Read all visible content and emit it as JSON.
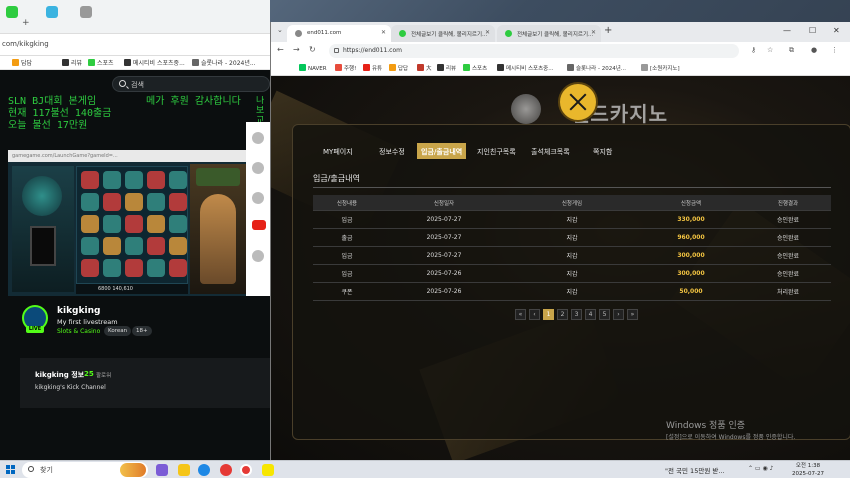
{
  "colors": {
    "kick_green": "#53fc18",
    "overlay_green": "#2ecc40",
    "site_gold": "#c9a54a",
    "amount_yellow": "#f4c542"
  },
  "left_browser": {
    "address": "com/kikgking",
    "bookmarks": [
      "답답",
      "리뷰",
      "스포츠",
      "메시티비 스포츠중...",
      "슬롯나라 - 2024년..."
    ],
    "search_placeholder": "검색",
    "overlay": {
      "line1": "SLN BJ대회 본게임",
      "line1b": "메가 후원 감사합니다",
      "line2": "현재 117불선 140출금",
      "line3": "오늘 불선 17만원",
      "side": "나보교리"
    },
    "stream_url": "gamegame.com/LaunchGame?gameId=...",
    "stream_hud": "6800 140,610",
    "channel": {
      "name": "kikgking",
      "title": "My first livestream",
      "category": "Slots & Casino",
      "tags": [
        "Korean",
        "18+"
      ],
      "live_label": "LIVE"
    },
    "about": {
      "title": "kikgking 정보",
      "followers": "25",
      "followers_label": "팔로워",
      "description": "kikgking's Kick Channel"
    }
  },
  "right_browser": {
    "tabs": [
      {
        "label": "end011.com",
        "active": true
      },
      {
        "label": "전체글보기 클릭해, 볼리지르기...",
        "active": false
      },
      {
        "label": "전체글보기 클릭해, 볼리지르기...",
        "active": false
      }
    ],
    "url": "https://end011.com",
    "bookmarks": [
      "NAVER",
      "주행!",
      "유튜",
      "답답",
      "大",
      "리뷰",
      "스포츠",
      "메시티비 스포츠중...",
      "슬롯나라 - 2024년...",
      "[소원카지노]"
    ],
    "site": {
      "logo_text": "엔드카지노",
      "menu": [
        "MY페이지",
        "정보수정",
        "입금/출금내역",
        "지인친구목록",
        "출석체크목록",
        "쪽지함"
      ],
      "active_menu": 2,
      "section_title": "입금/출금내역",
      "table": {
        "headers": [
          "신청내용",
          "신청일자",
          "신청게임",
          "신청금액",
          "진행결과"
        ],
        "rows": [
          [
            "입금",
            "2025-07-27",
            "지갑",
            "330,000",
            "승인완료"
          ],
          [
            "출금",
            "2025-07-27",
            "지갑",
            "960,000",
            "승인완료"
          ],
          [
            "입금",
            "2025-07-27",
            "지갑",
            "300,000",
            "승인완료"
          ],
          [
            "입금",
            "2025-07-26",
            "지갑",
            "300,000",
            "승인완료"
          ],
          [
            "쿠폰",
            "2025-07-26",
            "지갑",
            "50,000",
            "처리완료"
          ]
        ]
      },
      "pager": [
        "«",
        "‹",
        "1",
        "2",
        "3",
        "4",
        "5",
        "›",
        "»"
      ],
      "pager_active": 2
    },
    "windows_activation": {
      "line1": "Windows 정품 인증",
      "line2": "[설정]으로 이동하여 Windows를 정품 인증합니다."
    }
  },
  "taskbar": {
    "search_placeholder": "찾기",
    "notification": "\"전 국민 15만원 받...",
    "time": "오전 1:38",
    "date": "2025-07-27"
  }
}
